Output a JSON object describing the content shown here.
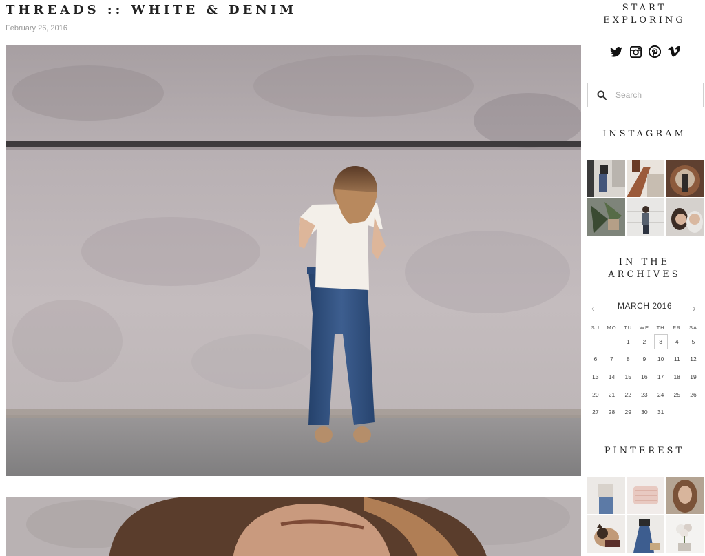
{
  "post": {
    "title": "THREADS :: WHITE & DENIM",
    "date": "February 26, 2016"
  },
  "sidebar": {
    "explore_title": "START EXPLORING",
    "social_icons": [
      "twitter-icon",
      "instagram-icon",
      "pinterest-icon",
      "vimeo-icon"
    ],
    "search": {
      "placeholder": "Search",
      "value": ""
    },
    "instagram_title": "INSTAGRAM",
    "archives_title": "IN THE ARCHIVES",
    "calendar": {
      "month": "MARCH 2016",
      "prev": "‹",
      "next": "›",
      "weekdays": [
        "SU",
        "MO",
        "TU",
        "WE",
        "TH",
        "FR",
        "SA"
      ],
      "weeks": [
        [
          "",
          "",
          "1",
          "2",
          "3",
          "4",
          "5"
        ],
        [
          "6",
          "7",
          "8",
          "9",
          "10",
          "11",
          "12"
        ],
        [
          "13",
          "14",
          "15",
          "16",
          "17",
          "18",
          "19"
        ],
        [
          "20",
          "21",
          "22",
          "23",
          "24",
          "25",
          "26"
        ],
        [
          "27",
          "28",
          "29",
          "30",
          "31",
          "",
          ""
        ]
      ],
      "today": "3"
    },
    "pinterest_title": "PINTEREST"
  },
  "colors": {
    "text": "#222222",
    "date": "#9a9a9a",
    "wall": "#bfb6b8",
    "denim": "#2f4f7e",
    "pavement": "#8c8b8c"
  }
}
